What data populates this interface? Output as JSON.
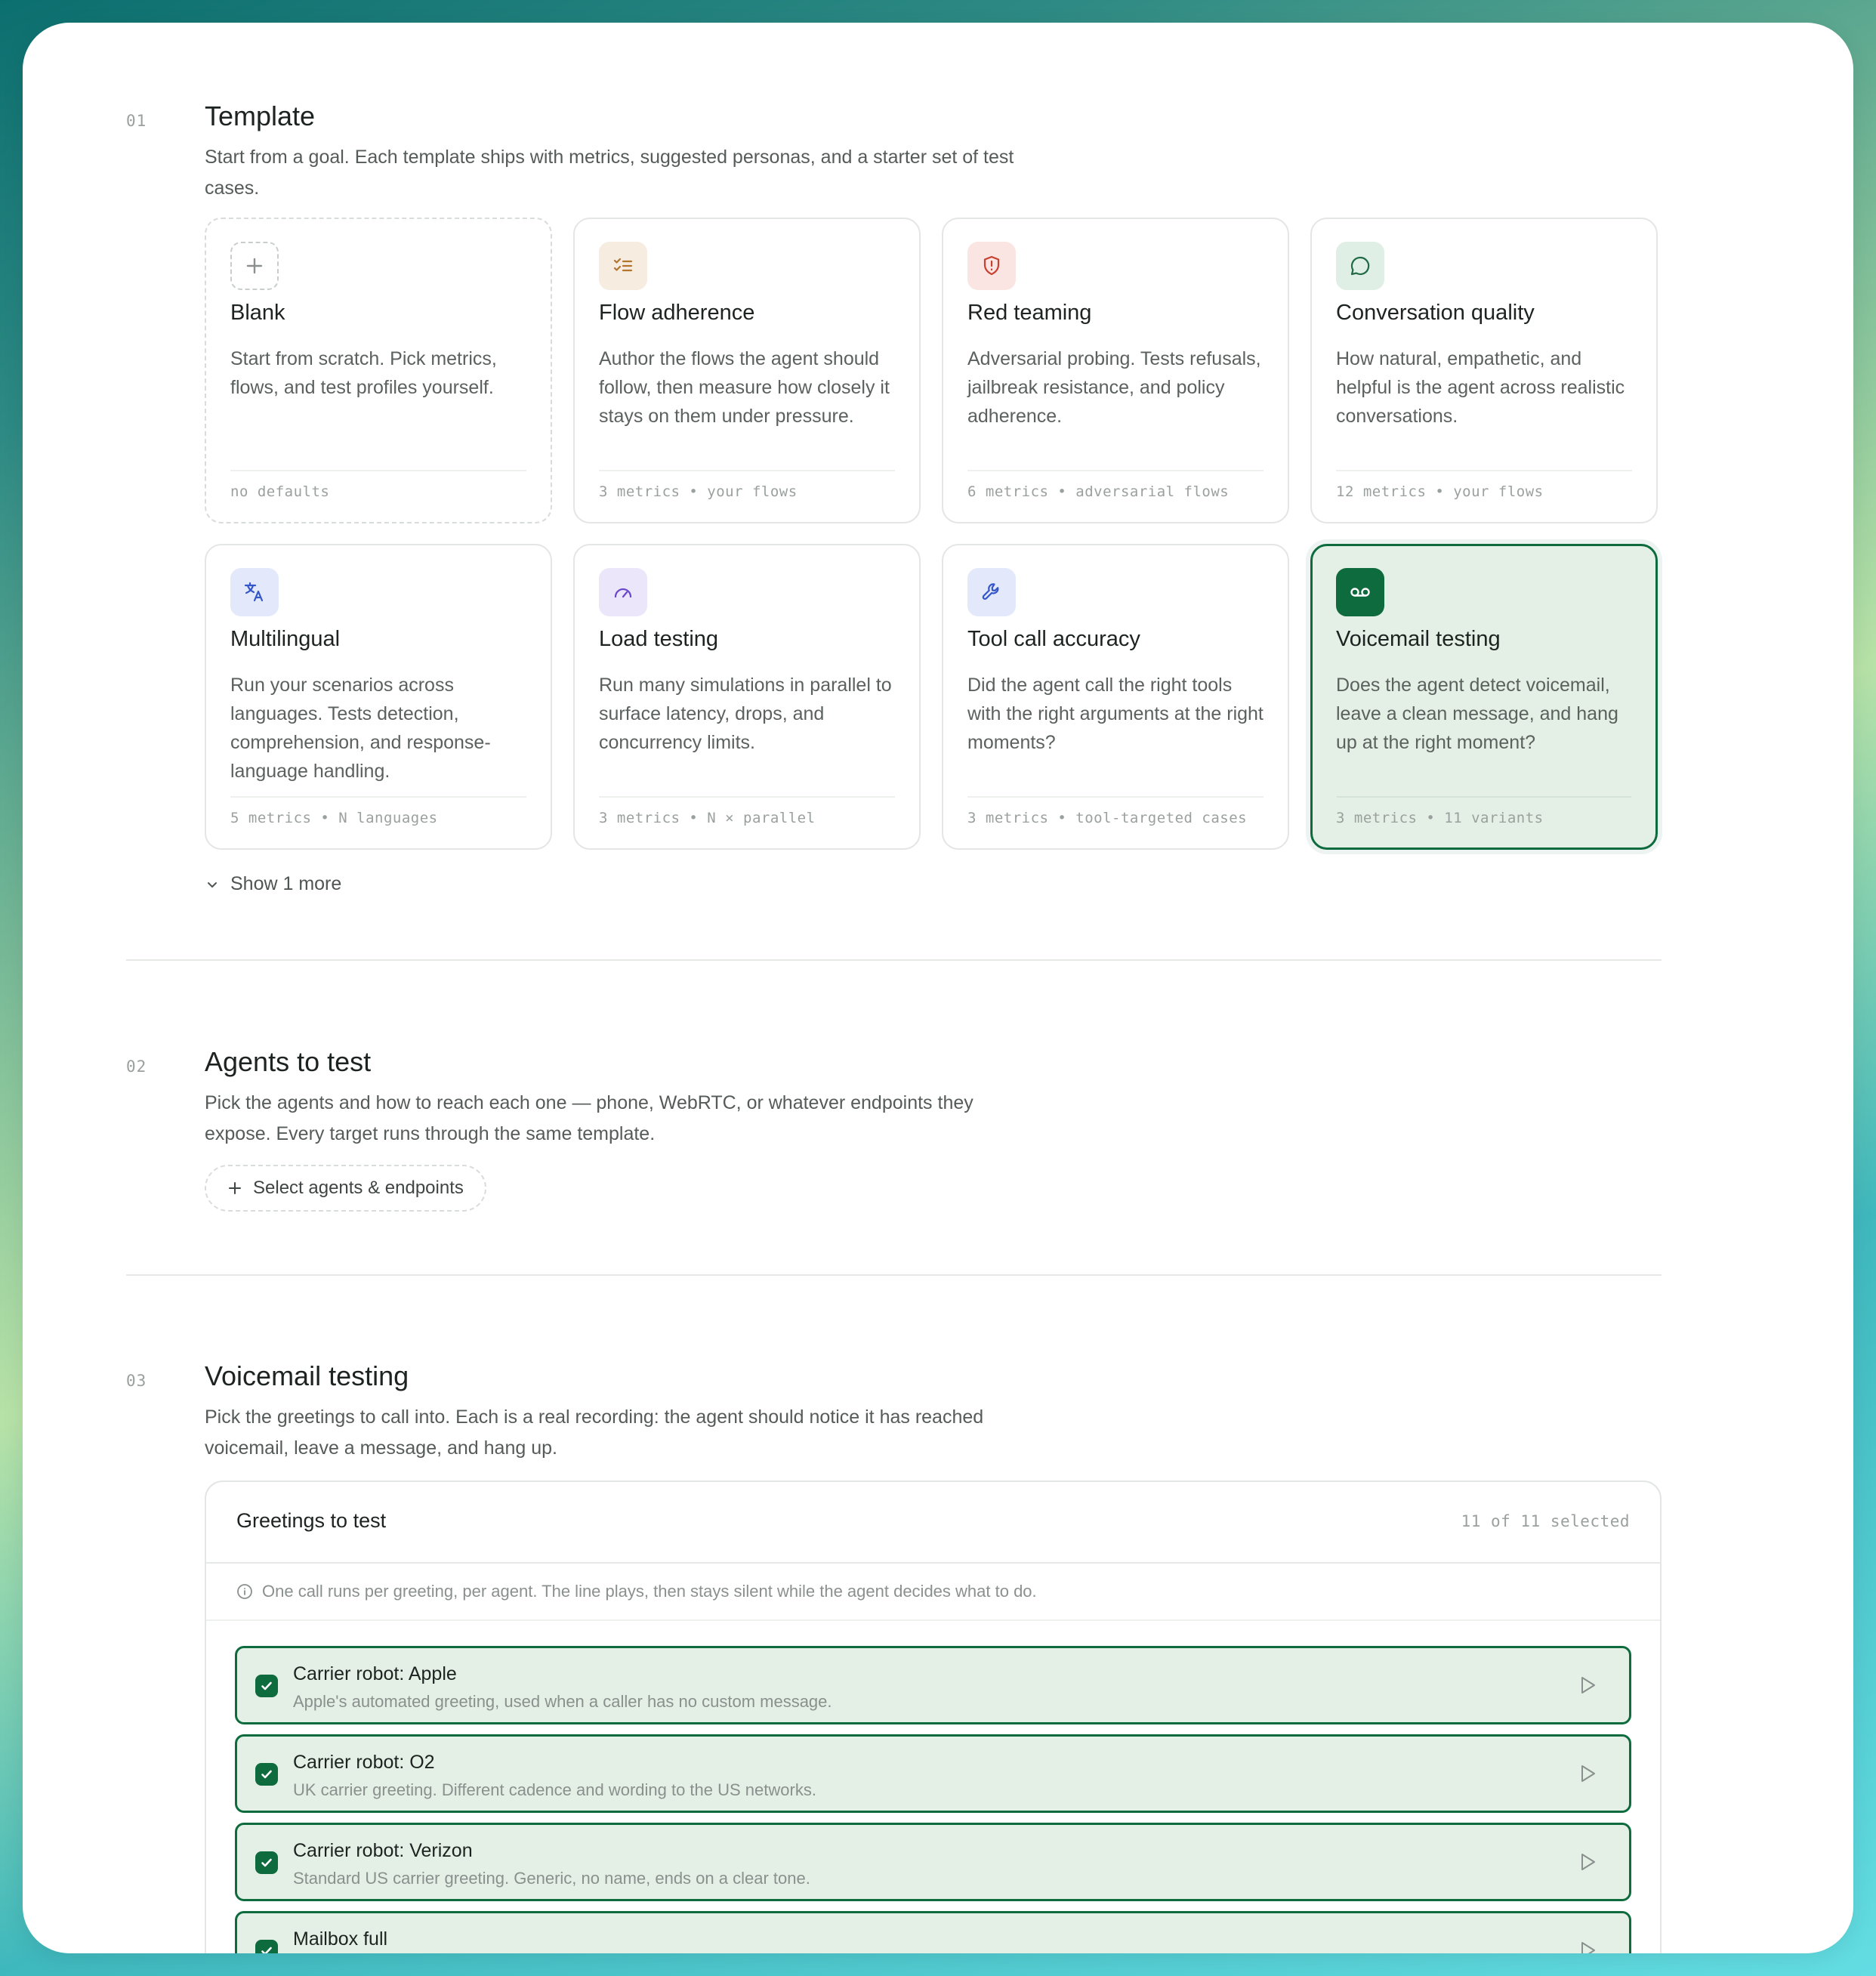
{
  "sections": {
    "template": {
      "num": "01",
      "title": "Template",
      "desc": "Start from a goal. Each template ships with metrics, suggested personas, and a starter set of test cases.",
      "show_more": "Show 1 more",
      "cards": [
        {
          "title": "Blank",
          "desc": "Start from scratch. Pick metrics, flows, and test profiles yourself.",
          "foot": "no defaults",
          "icon": "plus-icon"
        },
        {
          "title": "Flow adherence",
          "desc": "Author the flows the agent should follow, then measure how closely it stays on them under pressure.",
          "foot": "3 metrics • your flows",
          "icon": "list-check-icon"
        },
        {
          "title": "Red teaming",
          "desc": "Adversarial probing. Tests refusals, jailbreak resistance, and policy adherence.",
          "foot": "6 metrics • adversarial flows",
          "icon": "shield-alert-icon"
        },
        {
          "title": "Conversation quality",
          "desc": "How natural, empathetic, and helpful is the agent across realistic conversations.",
          "foot": "12 metrics • your flows",
          "icon": "chat-bubble-icon"
        },
        {
          "title": "Multilingual",
          "desc": "Run your scenarios across languages. Tests detection, comprehension, and response-language handling.",
          "foot": "5 metrics • N languages",
          "icon": "translate-icon"
        },
        {
          "title": "Load testing",
          "desc": "Run many simulations in parallel to surface latency, drops, and concurrency limits.",
          "foot": "3 metrics • N × parallel",
          "icon": "gauge-icon"
        },
        {
          "title": "Tool call accuracy",
          "desc": "Did the agent call the right tools with the right arguments at the right moments?",
          "foot": "3 metrics • tool-targeted cases",
          "icon": "wrench-icon"
        },
        {
          "title": "Voicemail testing",
          "desc": "Does the agent detect voicemail, leave a clean message, and hang up at the right moment?",
          "foot": "3 metrics • 11 variants",
          "icon": "voicemail-icon",
          "selected": true
        }
      ]
    },
    "agents": {
      "num": "02",
      "title": "Agents to test",
      "desc": "Pick the agents and how to reach each one — phone, WebRTC, or whatever endpoints they expose. Every target runs through the same template.",
      "button_label": "Select agents & endpoints"
    },
    "voicemail": {
      "num": "03",
      "title": "Voicemail testing",
      "desc": "Pick the greetings to call into. Each is a real recording: the agent should notice it has reached voicemail, leave a message, and hang up.",
      "panel": {
        "title": "Greetings to test",
        "count": "11 of 11 selected",
        "info": "One call runs per greeting, per agent. The line plays, then stays silent while the agent decides what to do.",
        "greetings": [
          {
            "title": "Carrier robot: Apple",
            "desc": "Apple's automated greeting, used when a caller has no custom message."
          },
          {
            "title": "Carrier robot: O2",
            "desc": "UK carrier greeting. Different cadence and wording to the US networks."
          },
          {
            "title": "Carrier robot: Verizon",
            "desc": "Standard US carrier greeting. Generic, no name, ends on a clear tone."
          },
          {
            "title": "Mailbox full",
            "desc": ""
          }
        ]
      }
    }
  },
  "colors": {
    "accent": "#0e6b3e",
    "selected_bg": "#e4efe6"
  }
}
